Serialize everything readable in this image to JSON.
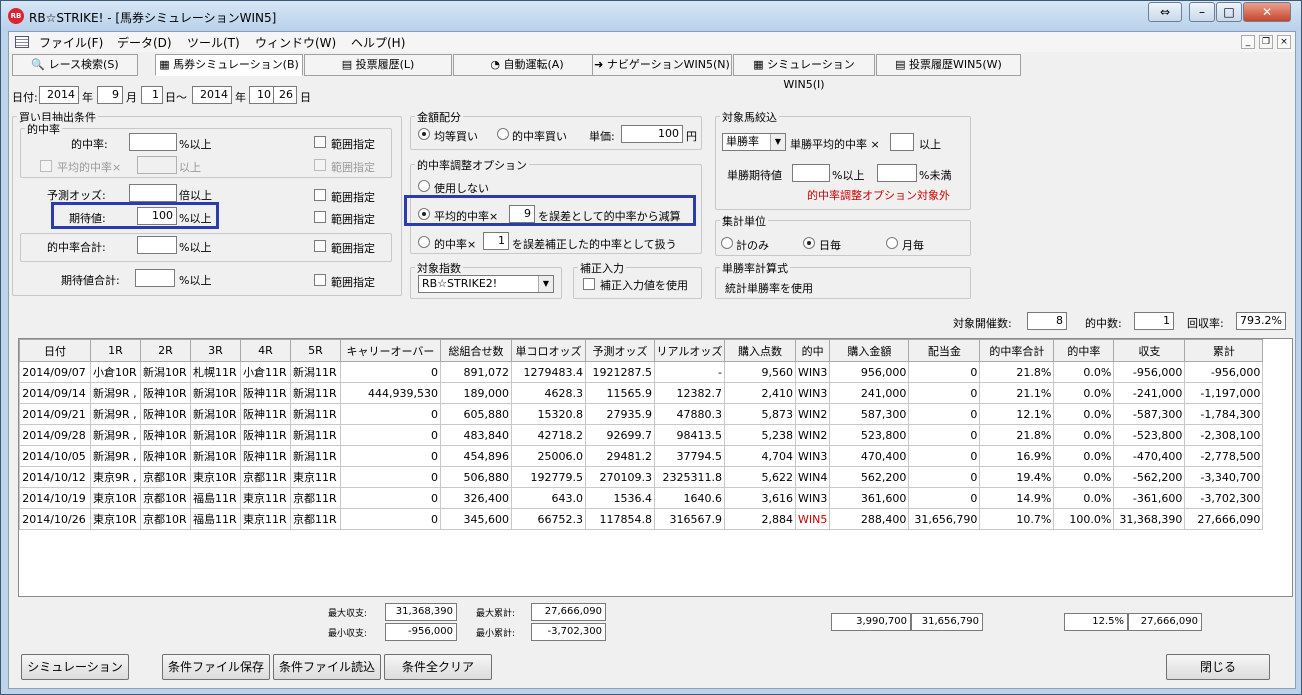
{
  "window": {
    "title": "RB☆STRIKE! - [馬券シミュレーションWIN5]",
    "icon": "app-logo-icon"
  },
  "menu": [
    "ファイル(F)",
    "データ(D)",
    "ツール(T)",
    "ウィンドウ(W)",
    "ヘルプ(H)"
  ],
  "tabs": [
    "レース検索(S)",
    "馬券シミュレーション(B)",
    "投票履歴(L)",
    "自動運転(A)",
    "ナビゲーションWIN5(N)",
    "シミュレーションWIN5(I)",
    "投票履歴WIN5(W)"
  ],
  "date_range": {
    "label": "日付:",
    "from_year": "2014",
    "from_month": "9",
    "from_day": "1",
    "to_year": "2014",
    "to_month": "10",
    "to_day": "26",
    "year": "年",
    "month": "月",
    "day": "日",
    "day_tilde": "日～"
  },
  "buy_conditions": {
    "title": "買い目抽出条件",
    "hit_rate_group": "的中率",
    "hit_rate": "的中率:",
    "pct_over": "%以上",
    "avg_hit_rate": "平均的中率×",
    "over": "以上",
    "pred_odds": "予測オッズ:",
    "times_over": "倍以上",
    "expected": "期待値:",
    "expected_value": "100",
    "hit_total": "的中率合計:",
    "expected_total": "期待値合計:",
    "range": "範囲指定"
  },
  "money": {
    "title": "金額配分",
    "equal": "均等買い",
    "hit_rate_buy": "的中率買い",
    "unit_label": "単価:",
    "unit_value": "100",
    "yen": "円"
  },
  "hit_adjust": {
    "title": "的中率調整オプション",
    "none": "使用しない",
    "opt1_pre": "平均的中率×",
    "opt1_value": "9",
    "opt1_post": "を誤差として的中率から減算",
    "opt2_pre": "的中率×",
    "opt2_value": "1",
    "opt2_post": "を誤差補正した的中率として扱う"
  },
  "target_index": {
    "title": "対象指数",
    "value": "RB☆STRIKE2!"
  },
  "correction": {
    "title": "補正入力",
    "label": "補正入力値を使用"
  },
  "target_horse": {
    "title": "対象馬絞込",
    "select": "単勝率",
    "avg_label": "単勝平均的中率 ×",
    "over": "以上",
    "exp_label": "単勝期待値",
    "pct_over": "%以上",
    "pct_under": "%未満",
    "note": "的中率調整オプション対象外"
  },
  "agg_unit": {
    "title": "集計単位",
    "total": "計のみ",
    "daily": "日毎",
    "monthly": "月毎"
  },
  "win_formula": {
    "title": "単勝率計算式",
    "value": "統計単勝率を使用"
  },
  "summary_top": {
    "events_label": "対象開催数:",
    "events": "8",
    "hits_label": "的中数:",
    "hits": "1",
    "recovery_label": "回収率:",
    "recovery": "793.2%"
  },
  "table": {
    "headers": [
      "日付",
      "1R",
      "2R",
      "3R",
      "4R",
      "5R",
      "キャリーオーバー",
      "総組合せ数",
      "単コロオッズ",
      "予測オッズ",
      "リアルオッズ",
      "購入点数",
      "的中",
      "購入金額",
      "配当金",
      "的中率合計",
      "的中率",
      "収支",
      "累計"
    ],
    "rows": [
      [
        "2014/09/07",
        "小倉10R",
        "新潟10R",
        "札幌11R",
        "小倉11R",
        "新潟11R",
        "0",
        "891,072",
        "1279483.4",
        "1921287.5",
        "-",
        "9,560",
        "WIN3",
        "956,000",
        "0",
        "21.8%",
        "0.0%",
        "-956,000",
        "-956,000"
      ],
      [
        "2014/09/14",
        "新潟9R ,",
        "阪神10R",
        "新潟10R",
        "阪神11R",
        "新潟11R",
        "444,939,530",
        "189,000",
        "4628.3",
        "11565.9",
        "12382.7",
        "2,410",
        "WIN3",
        "241,000",
        "0",
        "21.1%",
        "0.0%",
        "-241,000",
        "-1,197,000"
      ],
      [
        "2014/09/21",
        "新潟9R ,",
        "阪神10R",
        "新潟10R",
        "阪神11R",
        "新潟11R",
        "0",
        "605,880",
        "15320.8",
        "27935.9",
        "47880.3",
        "5,873",
        "WIN2",
        "587,300",
        "0",
        "12.1%",
        "0.0%",
        "-587,300",
        "-1,784,300"
      ],
      [
        "2014/09/28",
        "新潟9R ,",
        "阪神10R",
        "新潟10R",
        "阪神11R",
        "新潟11R",
        "0",
        "483,840",
        "42718.2",
        "92699.7",
        "98413.5",
        "5,238",
        "WIN2",
        "523,800",
        "0",
        "21.8%",
        "0.0%",
        "-523,800",
        "-2,308,100"
      ],
      [
        "2014/10/05",
        "新潟9R ,",
        "阪神10R",
        "新潟10R",
        "阪神11R",
        "新潟11R",
        "0",
        "454,896",
        "25006.0",
        "29481.2",
        "37794.5",
        "4,704",
        "WIN3",
        "470,400",
        "0",
        "16.9%",
        "0.0%",
        "-470,400",
        "-2,778,500"
      ],
      [
        "2014/10/12",
        "東京9R ,",
        "京都10R",
        "東京10R",
        "京都11R",
        "東京11R",
        "0",
        "506,880",
        "192779.5",
        "270109.3",
        "2325311.8",
        "5,622",
        "WIN4",
        "562,200",
        "0",
        "19.4%",
        "0.0%",
        "-562,200",
        "-3,340,700"
      ],
      [
        "2014/10/19",
        "東京10R",
        "京都10R",
        "福島11R",
        "東京11R",
        "京都11R",
        "0",
        "326,400",
        "643.0",
        "1536.4",
        "1640.6",
        "3,616",
        "WIN3",
        "361,600",
        "0",
        "14.9%",
        "0.0%",
        "-361,600",
        "-3,702,300"
      ],
      [
        "2014/10/26",
        "東京10R",
        "京都10R",
        "福島11R",
        "東京11R",
        "京都11R",
        "0",
        "345,600",
        "66752.3",
        "117854.8",
        "316567.9",
        "2,884",
        "WIN5",
        "288,400",
        "31,656,790",
        "10.7%",
        "100.0%",
        "31,368,390",
        "27,666,090"
      ]
    ],
    "win_color": "#cc0000"
  },
  "stats": {
    "max_income_label": "最大収支:",
    "max_income": "31,368,390",
    "min_income_label": "最小収支:",
    "min_income": "-956,000",
    "max_cum_label": "最大累計:",
    "max_cum": "27,666,090",
    "min_cum_label": "最小累計:",
    "min_cum": "-3,702,300",
    "total_purchase": "3,990,700",
    "total_payout": "31,656,790",
    "total_hit_rate": "12.5%",
    "total_cum": "27,666,090"
  },
  "buttons": {
    "simulation": "シミュレーション",
    "save": "条件ファイル保存",
    "load": "条件ファイル読込",
    "clear": "条件全クリア",
    "close": "閉じる"
  },
  "colors": {
    "highlight": "#2a3dab",
    "red_text": "#cc0000"
  }
}
